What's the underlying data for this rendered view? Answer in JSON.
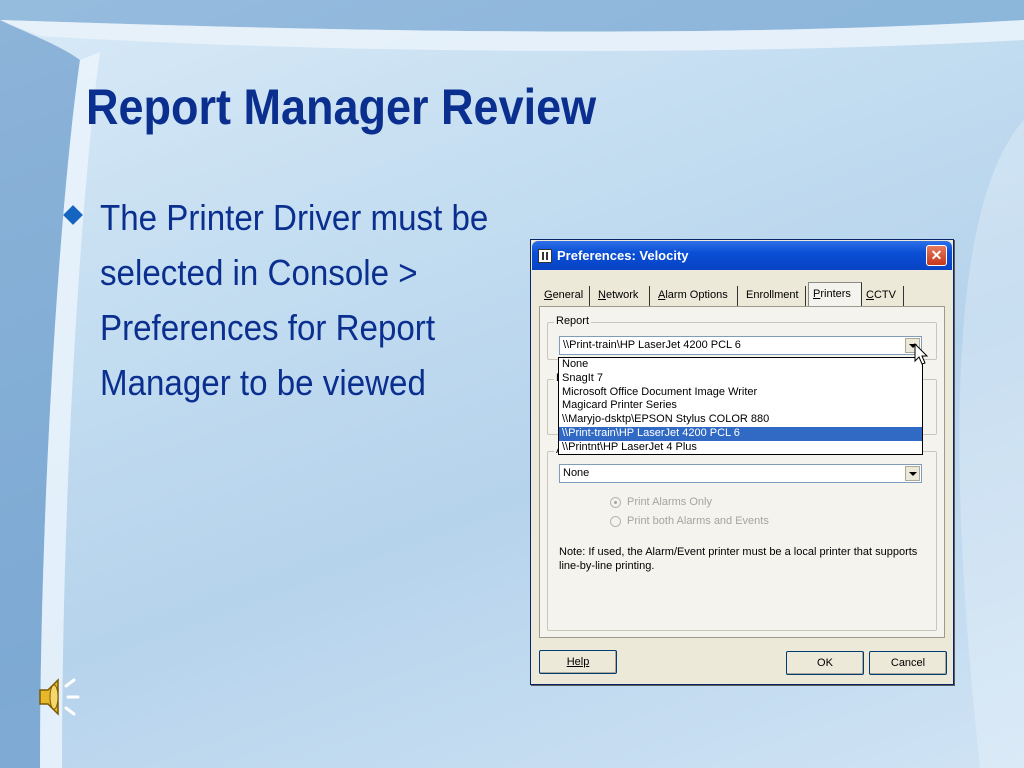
{
  "slide": {
    "title": "Report Manager Review",
    "bullet": "The Printer Driver must be selected in Console > Preferences for Report Manager to be viewed"
  },
  "dialog": {
    "title": "Preferences: Velocity",
    "close_label": "✕",
    "tabs": [
      {
        "label": "General",
        "underline": "G",
        "rest": "eneral"
      },
      {
        "label": "Network",
        "underline": "N",
        "rest": "etwork"
      },
      {
        "label": "Alarm Options",
        "underline": "A",
        "rest": "larm Options"
      },
      {
        "label": "Enrollment"
      },
      {
        "label": "Printers",
        "underline": "P",
        "rest": "rinters"
      },
      {
        "label": "CCTV",
        "underline": "C",
        "rest": "CTV"
      }
    ],
    "active_tab": "Printers",
    "report_group_label": "Report",
    "report_printer": "\\\\Print-train\\HP LaserJet 4200 PCL 6",
    "dropdown_options": [
      "None",
      "SnagIt 7",
      "Microsoft Office Document Image Writer",
      "Magicard Printer Series",
      "\\\\Maryjo-dsktp\\EPSON Stylus COLOR 880",
      "\\\\Print-train\\HP LaserJet 4200 PCL 6",
      "\\\\Printnt\\HP LaserJet 4 Plus"
    ],
    "selected_option": "\\\\Print-train\\HP LaserJet 4200 PCL 6",
    "badge_group_letter": "B",
    "alarm_group_letter": "A",
    "alarm_printer": "None",
    "radio_print_alarms_only": "Print Alarms Only",
    "radio_print_both": "Print both Alarms and Events",
    "note": "Note: If used, the Alarm/Event printer must be a local printer that supports line-by-line printing.",
    "help_button": "Help",
    "ok_button": "OK",
    "cancel_button": "Cancel"
  },
  "colors": {
    "title_text": "#0b2f8f",
    "bullet_text": "#0b2f8f",
    "bullet_marker": "#1565c0",
    "titlebar": "#0a4fd6",
    "selection": "#316ac5"
  },
  "icons": [
    "diamond-bullet-icon",
    "speaker-icon",
    "dialog-app-icon",
    "close-icon",
    "dropdown-arrow-icon",
    "mouse-cursor-icon"
  ]
}
